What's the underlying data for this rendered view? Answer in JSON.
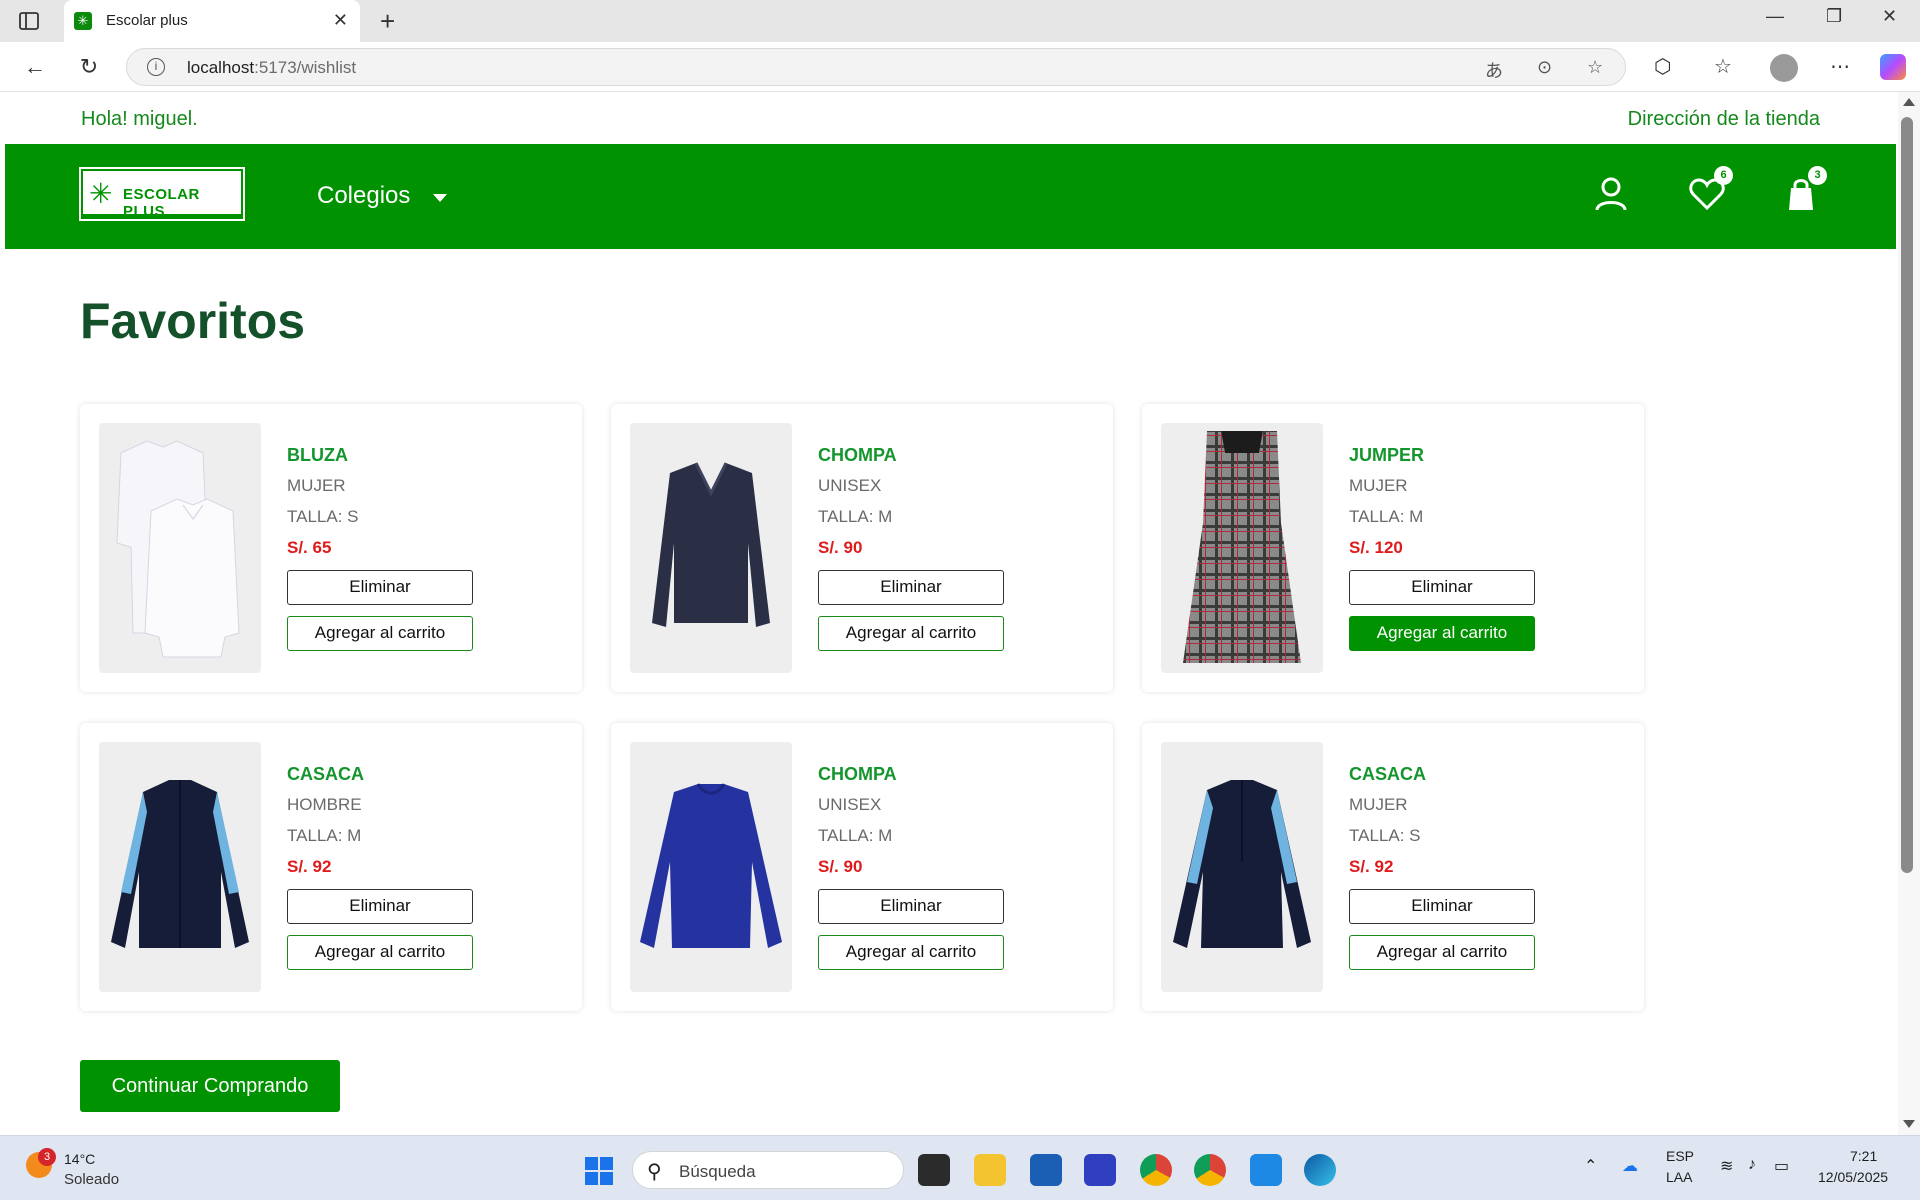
{
  "browser": {
    "tab_title": "Escolar plus",
    "url_host": "localhost",
    "url_rest": ":5173/wishlist"
  },
  "header": {
    "greeting": "Hola! miguel.",
    "store_link": "Dirección de la tienda",
    "logo_text": "ESCOLAR PLUS",
    "colegios": "Colegios",
    "wishlist_count": "6",
    "cart_count": "3"
  },
  "page_title": "Favoritos",
  "items": [
    {
      "name": "BLUZA",
      "gender": "MUJER",
      "size": "TALLA: S",
      "price": "S/. 65",
      "remove": "Eliminar",
      "add": "Agregar al carrito",
      "image": "white-blouse"
    },
    {
      "name": "CHOMPA",
      "gender": "UNISEX",
      "size": "TALLA: M",
      "price": "S/. 90",
      "remove": "Eliminar",
      "add": "Agregar al carrito",
      "image": "navy-vneck-sweater"
    },
    {
      "name": "JUMPER",
      "gender": "MUJER",
      "size": "TALLA: M",
      "price": "S/. 120",
      "remove": "Eliminar",
      "add": "Agregar al carrito",
      "image": "plaid-jumper"
    },
    {
      "name": "CASACA",
      "gender": "HOMBRE",
      "size": "TALLA: M",
      "price": "S/. 92",
      "remove": "Eliminar",
      "add": "Agregar al carrito",
      "image": "navy-jacket"
    },
    {
      "name": "CHOMPA",
      "gender": "UNISEX",
      "size": "TALLA: M",
      "price": "S/. 90",
      "remove": "Eliminar",
      "add": "Agregar al carrito",
      "image": "blue-sweatshirt"
    },
    {
      "name": "CASACA",
      "gender": "MUJER",
      "size": "TALLA: S",
      "price": "S/. 92",
      "remove": "Eliminar",
      "add": "Agregar al carrito",
      "image": "navy-jacket"
    }
  ],
  "continue_label": "Continuar Comprando",
  "taskbar": {
    "weather_badge": "3",
    "temp": "14°C",
    "weather": "Soleado",
    "search_placeholder": "Búsqueda",
    "lang_top": "ESP",
    "lang_bottom": "LAA",
    "time": "7:21",
    "date": "12/05/2025"
  },
  "colors": {
    "brand_green": "#019201",
    "heading": "#14512a",
    "price": "#e01b1b"
  }
}
